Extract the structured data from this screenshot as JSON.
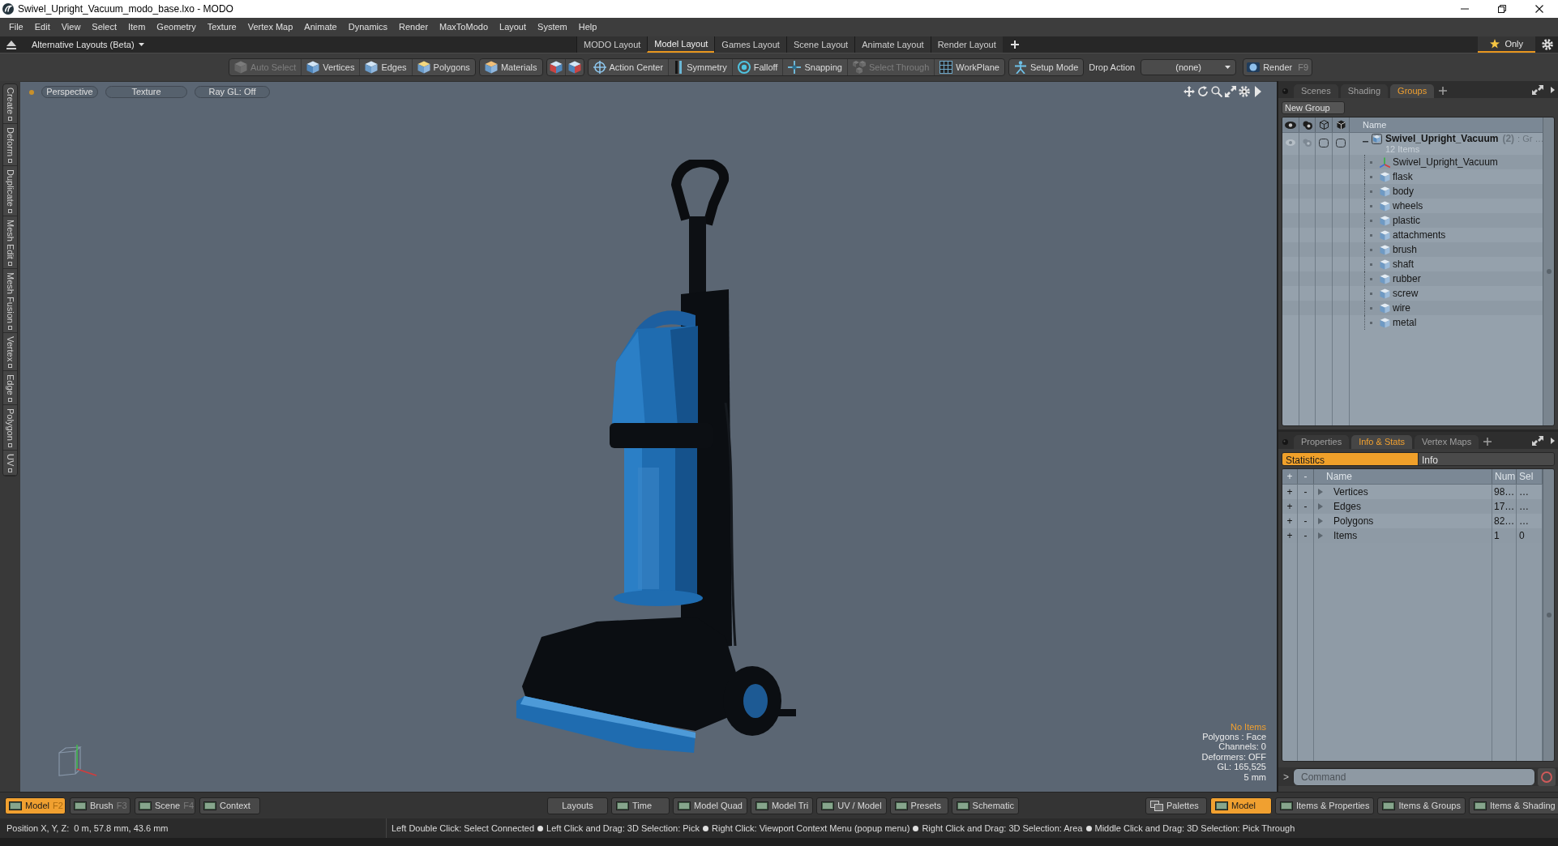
{
  "window": {
    "title": "Swivel_Upright_Vacuum_modo_base.lxo - MODO"
  },
  "menu": [
    "File",
    "Edit",
    "View",
    "Select",
    "Item",
    "Geometry",
    "Texture",
    "Vertex Map",
    "Animate",
    "Dynamics",
    "Render",
    "MaxToModo",
    "Layout",
    "System",
    "Help"
  ],
  "layout_bar": {
    "switcher": "Alternative Layouts (Beta)",
    "tabs": [
      {
        "label": "MODO Layout",
        "selected": false
      },
      {
        "label": "Model Layout",
        "selected": true
      },
      {
        "label": "Games Layout",
        "selected": false
      },
      {
        "label": "Scene Layout",
        "selected": false
      },
      {
        "label": "Animate Layout",
        "selected": false
      },
      {
        "label": "Render Layout",
        "selected": false
      }
    ],
    "filter": {
      "label": "Only",
      "on": true
    }
  },
  "toolbar": {
    "groups": [
      [
        {
          "kind": "tool",
          "label": "Auto Select",
          "disabled": true
        },
        {
          "kind": "tool",
          "label": "Vertices",
          "disabled": false
        },
        {
          "kind": "tool",
          "label": "Edges",
          "disabled": false
        },
        {
          "kind": "tool",
          "label": "Polygons",
          "disabled": false
        }
      ],
      [
        {
          "kind": "tool",
          "label": "Materials",
          "disabled": false
        }
      ],
      [
        {
          "kind": "icon",
          "disabled": false
        },
        {
          "kind": "icon",
          "disabled": false
        }
      ],
      [
        {
          "kind": "tool",
          "label": "Action Center",
          "disabled": false
        },
        {
          "kind": "tool",
          "label": "Symmetry",
          "disabled": false
        },
        {
          "kind": "tool",
          "label": "Falloff",
          "disabled": false
        },
        {
          "kind": "tool",
          "label": "Snapping",
          "disabled": false
        },
        {
          "kind": "tool",
          "label": "Select Through",
          "disabled": true
        },
        {
          "kind": "tool",
          "label": "WorkPlane",
          "disabled": false
        }
      ],
      [
        {
          "kind": "tool",
          "label": "Setup Mode",
          "disabled": false
        }
      ]
    ],
    "drop_action": {
      "label": "Drop Action",
      "value": "(none)"
    },
    "render": {
      "label": "Render",
      "shortcut": "F9"
    }
  },
  "side_tabs": [
    "Create",
    "Deform",
    "Duplicate",
    "Mesh Edit",
    "Mesh Fusion",
    "Vertex",
    "Edge",
    "Polygon",
    "UV"
  ],
  "viewport": {
    "buttons": [
      "Perspective",
      "Texture",
      "Ray GL: Off"
    ],
    "info": [
      {
        "text": "No Items",
        "kind": "alert"
      },
      {
        "text": "Polygons : Face",
        "kind": "plain"
      },
      {
        "text": "Channels: 0",
        "kind": "plain"
      },
      {
        "text": "Deformers: OFF",
        "kind": "plain"
      },
      {
        "text": "GL: 165,525",
        "kind": "plain"
      },
      {
        "text": "5 mm",
        "kind": "plain"
      }
    ]
  },
  "groups_panel": {
    "tabs": [
      {
        "label": "Scenes",
        "selected": false
      },
      {
        "label": "Shading",
        "selected": false
      },
      {
        "label": "Groups",
        "selected": true
      }
    ],
    "new_group": "New Group",
    "name_column": "Name",
    "tree": [
      {
        "label": "Swivel_Upright_Vacuum",
        "count": "(2)",
        "suffix": ": Gr …",
        "note": "12 Items",
        "expanded": true,
        "children": [
          {
            "label": "Swivel_Upright_Vacuum",
            "kind": "locator"
          },
          {
            "label": "flask",
            "kind": "mesh"
          },
          {
            "label": "body",
            "kind": "mesh"
          },
          {
            "label": "wheels",
            "kind": "mesh"
          },
          {
            "label": "plastic",
            "kind": "mesh"
          },
          {
            "label": "attachments",
            "kind": "mesh"
          },
          {
            "label": "brush",
            "kind": "mesh"
          },
          {
            "label": "shaft",
            "kind": "mesh"
          },
          {
            "label": "rubber",
            "kind": "mesh"
          },
          {
            "label": "screw",
            "kind": "mesh"
          },
          {
            "label": "wire",
            "kind": "mesh"
          },
          {
            "label": "metal",
            "kind": "mesh"
          }
        ]
      }
    ]
  },
  "stats_panel": {
    "tabs": [
      {
        "label": "Properties",
        "selected": false
      },
      {
        "label": "Info & Stats",
        "selected": true
      },
      {
        "label": "Vertex Maps",
        "selected": false
      }
    ],
    "modes": [
      {
        "label": "Statistics",
        "selected": true
      },
      {
        "label": "Info",
        "selected": false
      }
    ],
    "columns": [
      "+",
      "-",
      "Name",
      "Num",
      "Sel"
    ],
    "rows": [
      {
        "add": "+",
        "remove": "-",
        "name": "Vertices",
        "num": "98…",
        "sel": "…",
        "expanded": false
      },
      {
        "add": "+",
        "remove": "-",
        "name": "Edges",
        "num": "17…",
        "sel": "…",
        "expanded": false
      },
      {
        "add": "+",
        "remove": "-",
        "name": "Polygons",
        "num": "82…",
        "sel": "…",
        "expanded": false
      },
      {
        "add": "+",
        "remove": "-",
        "name": "Items",
        "num": "1",
        "sel": "0",
        "expanded": false
      }
    ],
    "command": {
      "prompt": ">",
      "placeholder": "Command"
    }
  },
  "bottom_bar": {
    "left": [
      {
        "label": "Model",
        "shortcut": "F2",
        "selected": true
      },
      {
        "label": "Brush",
        "shortcut": "F3",
        "selected": false
      },
      {
        "label": "Scene",
        "shortcut": "F4",
        "selected": false
      },
      {
        "label": "Context",
        "selected": false
      }
    ],
    "center": [
      {
        "label": "Layouts",
        "kind": "plain",
        "selected": false
      },
      {
        "label": "Time",
        "kind": "layout",
        "selected": false
      },
      {
        "label": "Model Quad",
        "kind": "layout",
        "selected": false
      },
      {
        "label": "Model Tri",
        "kind": "layout",
        "selected": false
      },
      {
        "label": "UV / Model",
        "kind": "layout",
        "selected": false
      },
      {
        "label": "Presets",
        "kind": "layout",
        "selected": false
      },
      {
        "label": "Schematic",
        "kind": "layout",
        "selected": false
      }
    ],
    "right": [
      {
        "label": "Palettes",
        "kind": "palette",
        "selected": false
      },
      {
        "label": "Model",
        "kind": "layout",
        "selected": true
      },
      {
        "label": "Items & Properties",
        "kind": "layout",
        "selected": false
      },
      {
        "label": "Items & Groups",
        "kind": "layout",
        "selected": false
      },
      {
        "label": "Items & Shading",
        "kind": "layout",
        "selected": false
      }
    ]
  },
  "status_bar": {
    "position": "Position X, Y, Z:  0 m, 57.8 mm, 43.6 mm",
    "hints": [
      "Left Double Click: Select Connected",
      "Left Click and Drag: 3D Selection: Pick",
      "Right Click: Viewport Context Menu (popup menu)",
      "Right Click and Drag: 3D Selection: Area",
      "Middle Click and Drag: 3D Selection: Pick Through"
    ]
  }
}
